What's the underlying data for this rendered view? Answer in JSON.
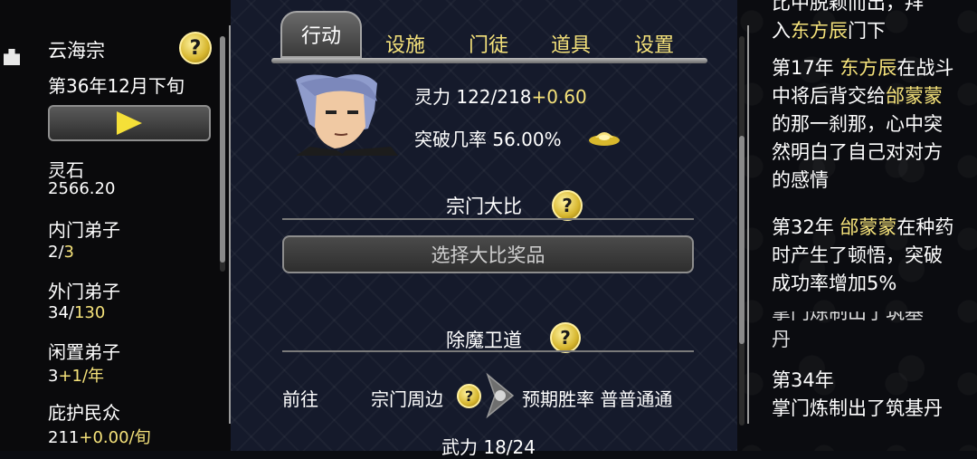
{
  "sect": {
    "name": "云海宗",
    "date": "第36年12月下旬"
  },
  "stats": [
    {
      "label": "灵石",
      "value": "2566.20",
      "extra": ""
    },
    {
      "label": "内门弟子",
      "value": "2/",
      "extra": "3"
    },
    {
      "label": "外门弟子",
      "value": "34/",
      "extra": "130"
    },
    {
      "label": "闲置弟子",
      "value": "3",
      "extra": "+1/年"
    },
    {
      "label": "庇护民众",
      "value": "211",
      "extra": "+0.00/旬"
    }
  ],
  "tabs": {
    "active": "行动",
    "others": [
      "设施",
      "门徒",
      "道具",
      "设置"
    ]
  },
  "cultivation": {
    "spirit_label": "灵力 122/218",
    "spirit_rate": "+0.60",
    "break_label": "突破几率 56.00%"
  },
  "tournament": {
    "title": "宗门大比",
    "button": "选择大比奖品"
  },
  "demon": {
    "title": "除魔卫道",
    "go": "前往",
    "place": "宗门周边",
    "odds": "预期胜率 普普通通",
    "force": "武力 18/24"
  },
  "log": {
    "top_line1": "比中脱颖而出，拜",
    "top_line2_a": "入",
    "top_line2_name": "东方辰",
    "top_line2_b": "门下",
    "e1_year": "第17年 ",
    "e1_name": "东方辰",
    "e1_text_a": "在战斗中将后背交给",
    "e1_name2": "邰蒙蒙",
    "e1_text_b": "的那一刹那，心中突然明白了自己对对方的感情",
    "e2_year": "第32年 ",
    "e2_name": "邰蒙蒙",
    "e2_text": "在种药时产生了顿悟，突破成功率增加5%",
    "ghost_line": "掌门炼制出了筑基",
    "ghost_line2": "丹",
    "e3_year": "第34年",
    "e3_text": "掌门炼制出了筑基丹"
  },
  "colors": {
    "accent": "#f5e27a",
    "panel": "#151a2b"
  }
}
